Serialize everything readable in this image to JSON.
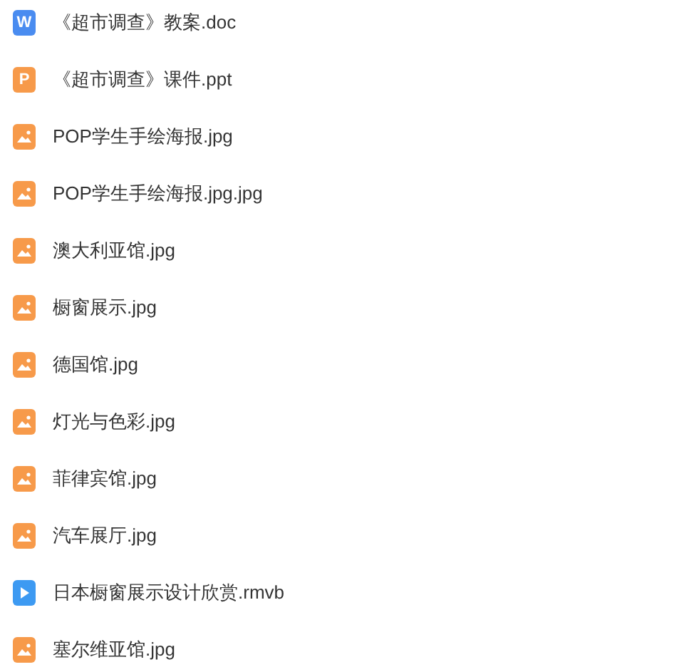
{
  "files": [
    {
      "name": "《超市调查》教案.doc",
      "kind": "doc",
      "badge": "W"
    },
    {
      "name": "《超市调查》课件.ppt",
      "kind": "ppt",
      "badge": "P"
    },
    {
      "name": "POP学生手绘海报.jpg",
      "kind": "image"
    },
    {
      "name": "POP学生手绘海报.jpg.jpg",
      "kind": "image"
    },
    {
      "name": "澳大利亚馆.jpg",
      "kind": "image"
    },
    {
      "name": "橱窗展示.jpg",
      "kind": "image"
    },
    {
      "name": "德国馆.jpg",
      "kind": "image"
    },
    {
      "name": "灯光与色彩.jpg",
      "kind": "image"
    },
    {
      "name": "菲律宾馆.jpg",
      "kind": "image"
    },
    {
      "name": "汽车展厅.jpg",
      "kind": "image"
    },
    {
      "name": "日本橱窗展示设计欣赏.rmvb",
      "kind": "video"
    },
    {
      "name": "塞尔维亚馆.jpg",
      "kind": "image"
    }
  ]
}
